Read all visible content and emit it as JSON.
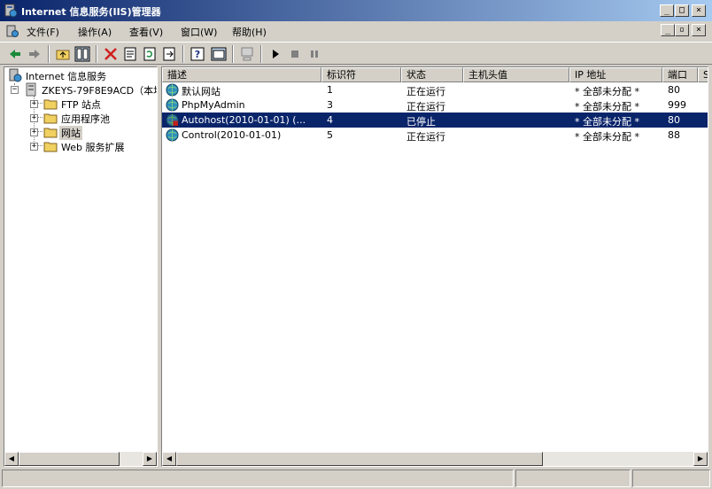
{
  "window": {
    "title": "Internet 信息服务(IIS)管理器"
  },
  "window_buttons": {
    "minimize": "_",
    "restore": "□",
    "close": "×"
  },
  "child_buttons": {
    "minimize": "_",
    "restore": "▫",
    "close": "×"
  },
  "menu": [
    "文件(F)",
    "操作(A)",
    "查看(V)",
    "窗口(W)",
    "帮助(H)"
  ],
  "toolbar": [
    "back-icon",
    "forward-icon",
    "up-folder-icon",
    "show-tree-icon",
    "delete-icon",
    "properties-icon",
    "refresh-icon",
    "export-icon",
    "help-icon",
    "console-icon",
    "computer-icon",
    "play-icon",
    "stop-icon",
    "pause-icon"
  ],
  "tree": {
    "root": "Internet 信息服务",
    "server": "ZKEYS-79F8E9ACD（本地计",
    "children": [
      "FTP 站点",
      "应用程序池",
      "网站",
      "Web 服务扩展"
    ],
    "selected": "网站"
  },
  "columns": [
    "描述",
    "标识符",
    "状态",
    "主机头值",
    "IP 地址",
    "端口",
    "S"
  ],
  "sites": [
    {
      "desc": "默认网站",
      "id": "1",
      "status": "正在运行",
      "host": "",
      "ip": "* 全部未分配 *",
      "port": "80",
      "selected": false
    },
    {
      "desc": "PhpMyAdmin",
      "id": "3",
      "status": "正在运行",
      "host": "",
      "ip": "* 全部未分配 *",
      "port": "999",
      "selected": false
    },
    {
      "desc": "Autohost(2010-01-01) (...",
      "id": "4",
      "status": "已停止",
      "host": "",
      "ip": "* 全部未分配 *",
      "port": "80",
      "selected": true
    },
    {
      "desc": "Control(2010-01-01)",
      "id": "5",
      "status": "正在运行",
      "host": "",
      "ip": "* 全部未分配 *",
      "port": "88",
      "selected": false
    }
  ],
  "colors": {
    "selection": "#0a246a",
    "titlebar_start": "#0a246a",
    "titlebar_end": "#a6caf0",
    "face": "#d4d0c8"
  }
}
